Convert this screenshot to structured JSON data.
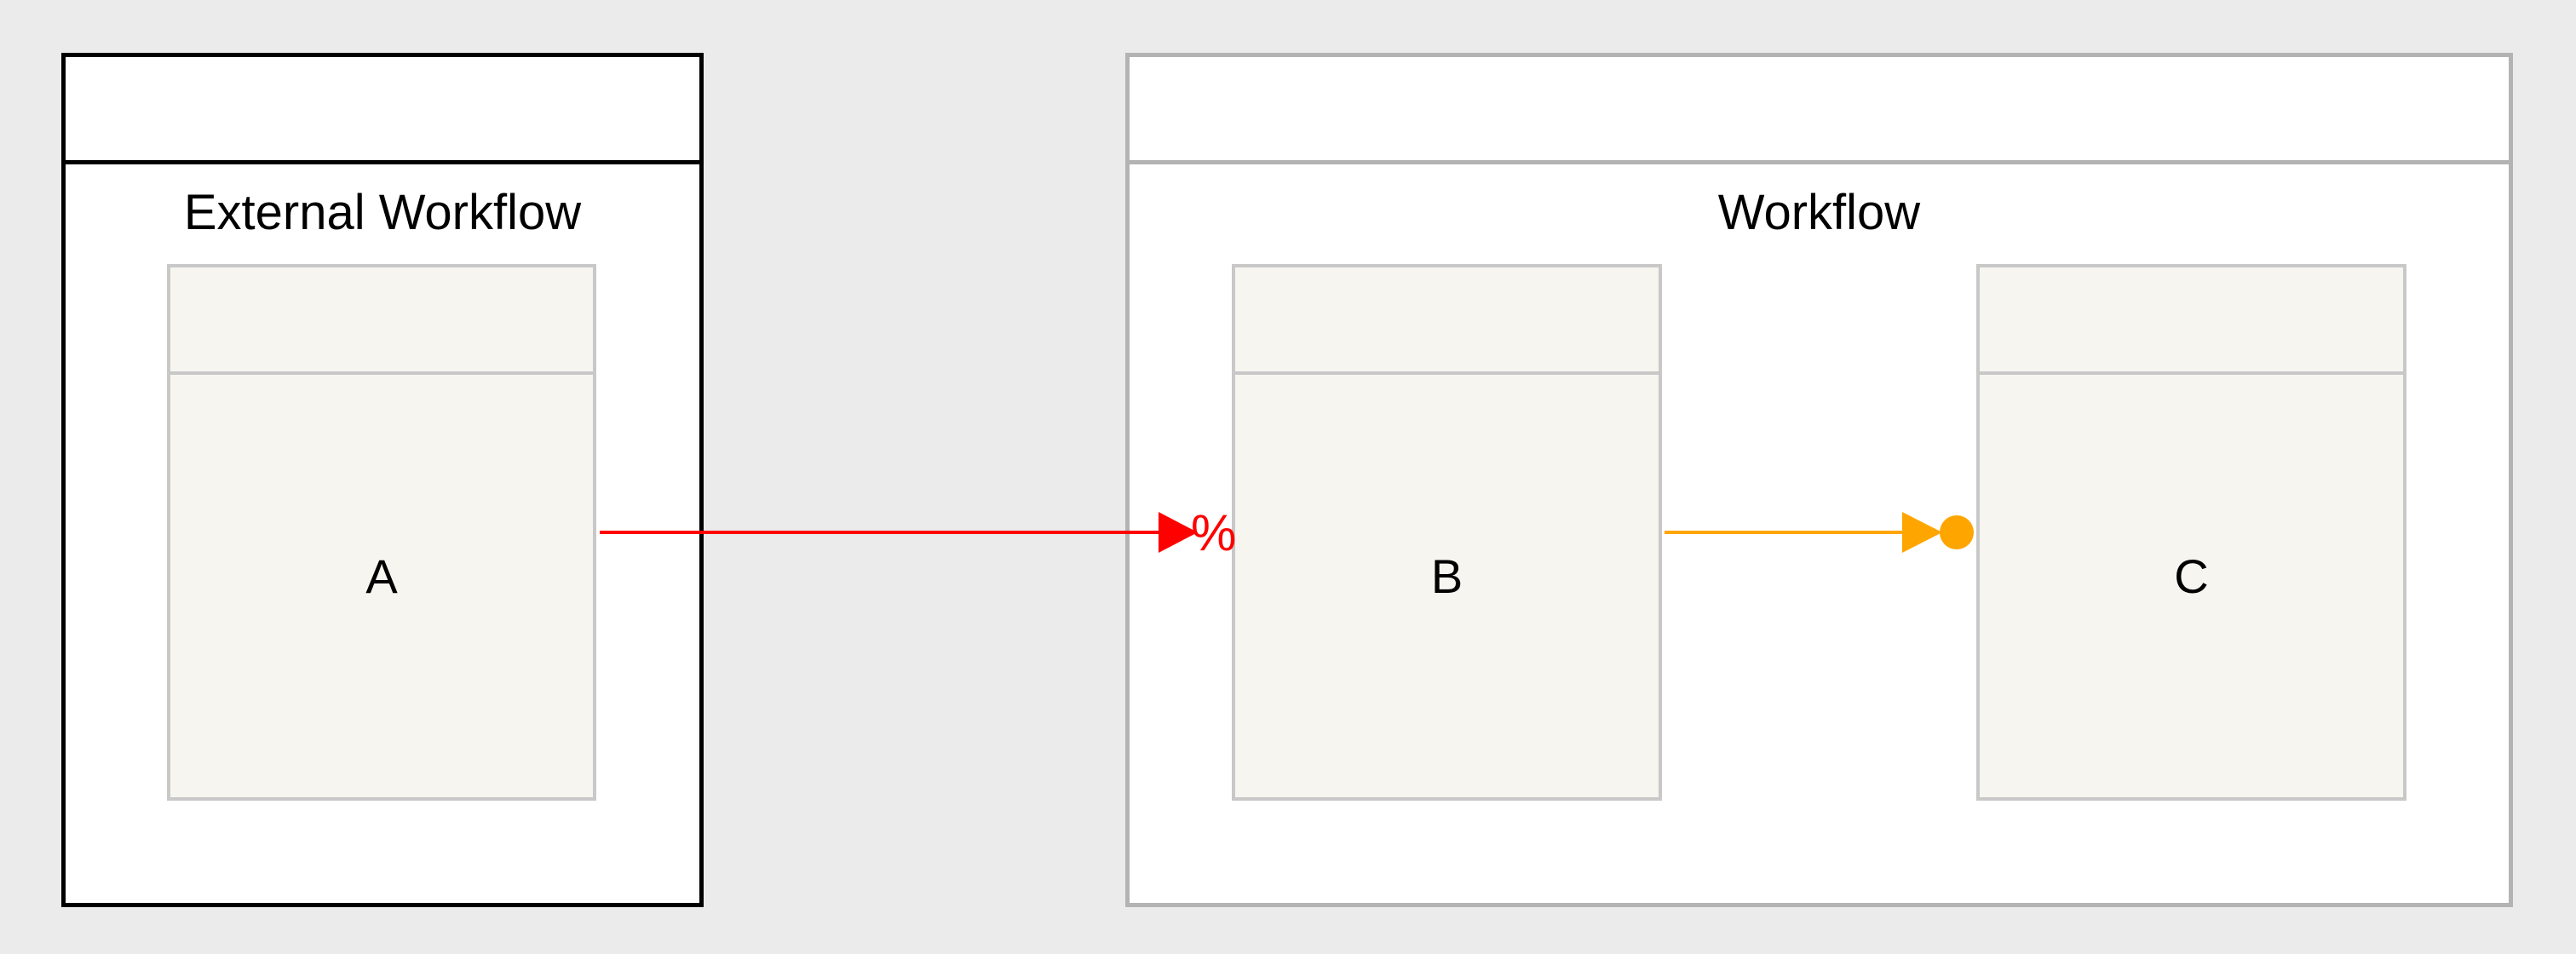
{
  "diagram": {
    "external_container": {
      "title": "External Workflow"
    },
    "workflow_container": {
      "title": "Workflow"
    },
    "nodes": [
      {
        "id": "A",
        "label": "A"
      },
      {
        "id": "B",
        "label": "B"
      },
      {
        "id": "C",
        "label": "C"
      }
    ],
    "edges": [
      {
        "from": "A",
        "to": "B",
        "color": "#ff0000",
        "head": "arrow",
        "marker": "%"
      },
      {
        "from": "B",
        "to": "C",
        "color": "#ffa500",
        "head": "arrow-dot"
      }
    ]
  }
}
